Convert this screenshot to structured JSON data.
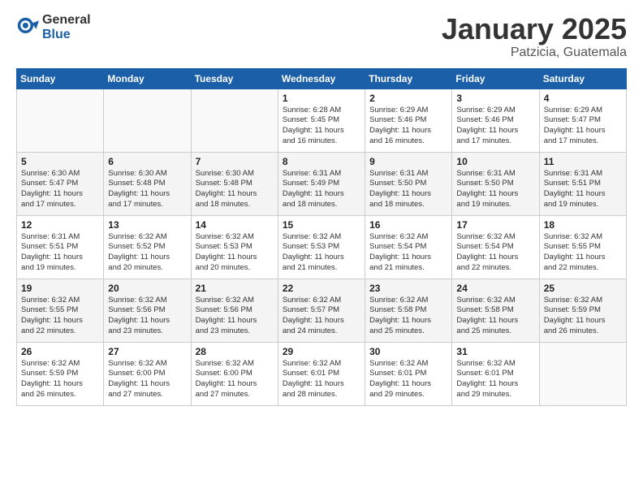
{
  "logo": {
    "general": "General",
    "blue": "Blue"
  },
  "header": {
    "title": "January 2025",
    "subtitle": "Patzicia, Guatemala"
  },
  "weekdays": [
    "Sunday",
    "Monday",
    "Tuesday",
    "Wednesday",
    "Thursday",
    "Friday",
    "Saturday"
  ],
  "weeks": [
    [
      {
        "day": "",
        "info": ""
      },
      {
        "day": "",
        "info": ""
      },
      {
        "day": "",
        "info": ""
      },
      {
        "day": "1",
        "info": "Sunrise: 6:28 AM\nSunset: 5:45 PM\nDaylight: 11 hours\nand 16 minutes."
      },
      {
        "day": "2",
        "info": "Sunrise: 6:29 AM\nSunset: 5:46 PM\nDaylight: 11 hours\nand 16 minutes."
      },
      {
        "day": "3",
        "info": "Sunrise: 6:29 AM\nSunset: 5:46 PM\nDaylight: 11 hours\nand 17 minutes."
      },
      {
        "day": "4",
        "info": "Sunrise: 6:29 AM\nSunset: 5:47 PM\nDaylight: 11 hours\nand 17 minutes."
      }
    ],
    [
      {
        "day": "5",
        "info": "Sunrise: 6:30 AM\nSunset: 5:47 PM\nDaylight: 11 hours\nand 17 minutes."
      },
      {
        "day": "6",
        "info": "Sunrise: 6:30 AM\nSunset: 5:48 PM\nDaylight: 11 hours\nand 17 minutes."
      },
      {
        "day": "7",
        "info": "Sunrise: 6:30 AM\nSunset: 5:48 PM\nDaylight: 11 hours\nand 18 minutes."
      },
      {
        "day": "8",
        "info": "Sunrise: 6:31 AM\nSunset: 5:49 PM\nDaylight: 11 hours\nand 18 minutes."
      },
      {
        "day": "9",
        "info": "Sunrise: 6:31 AM\nSunset: 5:50 PM\nDaylight: 11 hours\nand 18 minutes."
      },
      {
        "day": "10",
        "info": "Sunrise: 6:31 AM\nSunset: 5:50 PM\nDaylight: 11 hours\nand 19 minutes."
      },
      {
        "day": "11",
        "info": "Sunrise: 6:31 AM\nSunset: 5:51 PM\nDaylight: 11 hours\nand 19 minutes."
      }
    ],
    [
      {
        "day": "12",
        "info": "Sunrise: 6:31 AM\nSunset: 5:51 PM\nDaylight: 11 hours\nand 19 minutes."
      },
      {
        "day": "13",
        "info": "Sunrise: 6:32 AM\nSunset: 5:52 PM\nDaylight: 11 hours\nand 20 minutes."
      },
      {
        "day": "14",
        "info": "Sunrise: 6:32 AM\nSunset: 5:53 PM\nDaylight: 11 hours\nand 20 minutes."
      },
      {
        "day": "15",
        "info": "Sunrise: 6:32 AM\nSunset: 5:53 PM\nDaylight: 11 hours\nand 21 minutes."
      },
      {
        "day": "16",
        "info": "Sunrise: 6:32 AM\nSunset: 5:54 PM\nDaylight: 11 hours\nand 21 minutes."
      },
      {
        "day": "17",
        "info": "Sunrise: 6:32 AM\nSunset: 5:54 PM\nDaylight: 11 hours\nand 22 minutes."
      },
      {
        "day": "18",
        "info": "Sunrise: 6:32 AM\nSunset: 5:55 PM\nDaylight: 11 hours\nand 22 minutes."
      }
    ],
    [
      {
        "day": "19",
        "info": "Sunrise: 6:32 AM\nSunset: 5:55 PM\nDaylight: 11 hours\nand 22 minutes."
      },
      {
        "day": "20",
        "info": "Sunrise: 6:32 AM\nSunset: 5:56 PM\nDaylight: 11 hours\nand 23 minutes."
      },
      {
        "day": "21",
        "info": "Sunrise: 6:32 AM\nSunset: 5:56 PM\nDaylight: 11 hours\nand 23 minutes."
      },
      {
        "day": "22",
        "info": "Sunrise: 6:32 AM\nSunset: 5:57 PM\nDaylight: 11 hours\nand 24 minutes."
      },
      {
        "day": "23",
        "info": "Sunrise: 6:32 AM\nSunset: 5:58 PM\nDaylight: 11 hours\nand 25 minutes."
      },
      {
        "day": "24",
        "info": "Sunrise: 6:32 AM\nSunset: 5:58 PM\nDaylight: 11 hours\nand 25 minutes."
      },
      {
        "day": "25",
        "info": "Sunrise: 6:32 AM\nSunset: 5:59 PM\nDaylight: 11 hours\nand 26 minutes."
      }
    ],
    [
      {
        "day": "26",
        "info": "Sunrise: 6:32 AM\nSunset: 5:59 PM\nDaylight: 11 hours\nand 26 minutes."
      },
      {
        "day": "27",
        "info": "Sunrise: 6:32 AM\nSunset: 6:00 PM\nDaylight: 11 hours\nand 27 minutes."
      },
      {
        "day": "28",
        "info": "Sunrise: 6:32 AM\nSunset: 6:00 PM\nDaylight: 11 hours\nand 27 minutes."
      },
      {
        "day": "29",
        "info": "Sunrise: 6:32 AM\nSunset: 6:01 PM\nDaylight: 11 hours\nand 28 minutes."
      },
      {
        "day": "30",
        "info": "Sunrise: 6:32 AM\nSunset: 6:01 PM\nDaylight: 11 hours\nand 29 minutes."
      },
      {
        "day": "31",
        "info": "Sunrise: 6:32 AM\nSunset: 6:01 PM\nDaylight: 11 hours\nand 29 minutes."
      },
      {
        "day": "",
        "info": ""
      }
    ]
  ]
}
